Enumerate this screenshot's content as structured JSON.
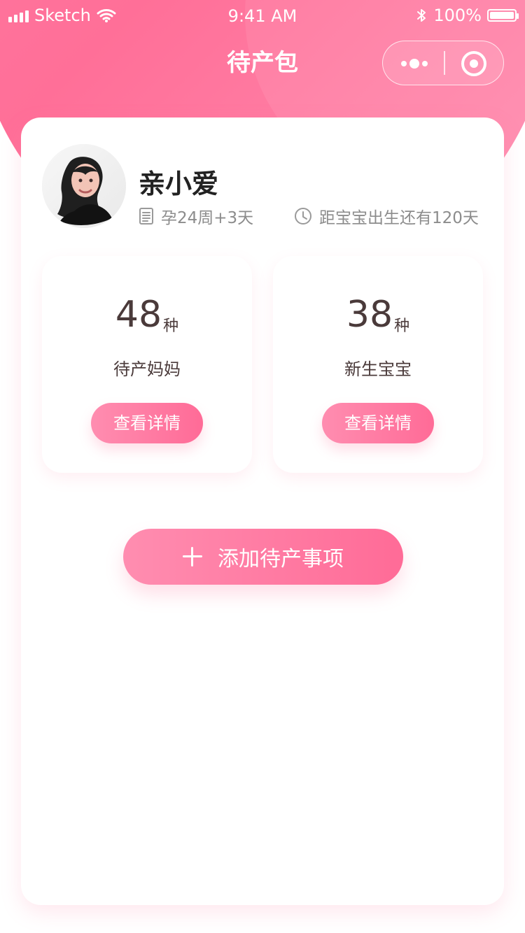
{
  "status_bar": {
    "carrier": "Sketch",
    "time": "9:41 AM",
    "battery": "100%"
  },
  "nav": {
    "title": "待产包"
  },
  "profile": {
    "name": "亲小爱",
    "pregnancy_week": "孕24周+3天",
    "due_countdown": "距宝宝出生还有120天"
  },
  "stats": [
    {
      "value": "48",
      "unit": "种",
      "label": "待产妈妈",
      "button": "查看详情"
    },
    {
      "value": "38",
      "unit": "种",
      "label": "新生宝宝",
      "button": "查看详情"
    }
  ],
  "actions": {
    "add_label": "添加待产事项"
  },
  "colors": {
    "brand_pink": "#ff6f98",
    "brand_pink_light": "#ff8db0",
    "text_dark": "#4a3a3a"
  },
  "icons": {
    "more": "more-icon",
    "target": "target-icon",
    "document": "document-icon",
    "clock": "clock-icon",
    "plus": "plus-icon"
  }
}
